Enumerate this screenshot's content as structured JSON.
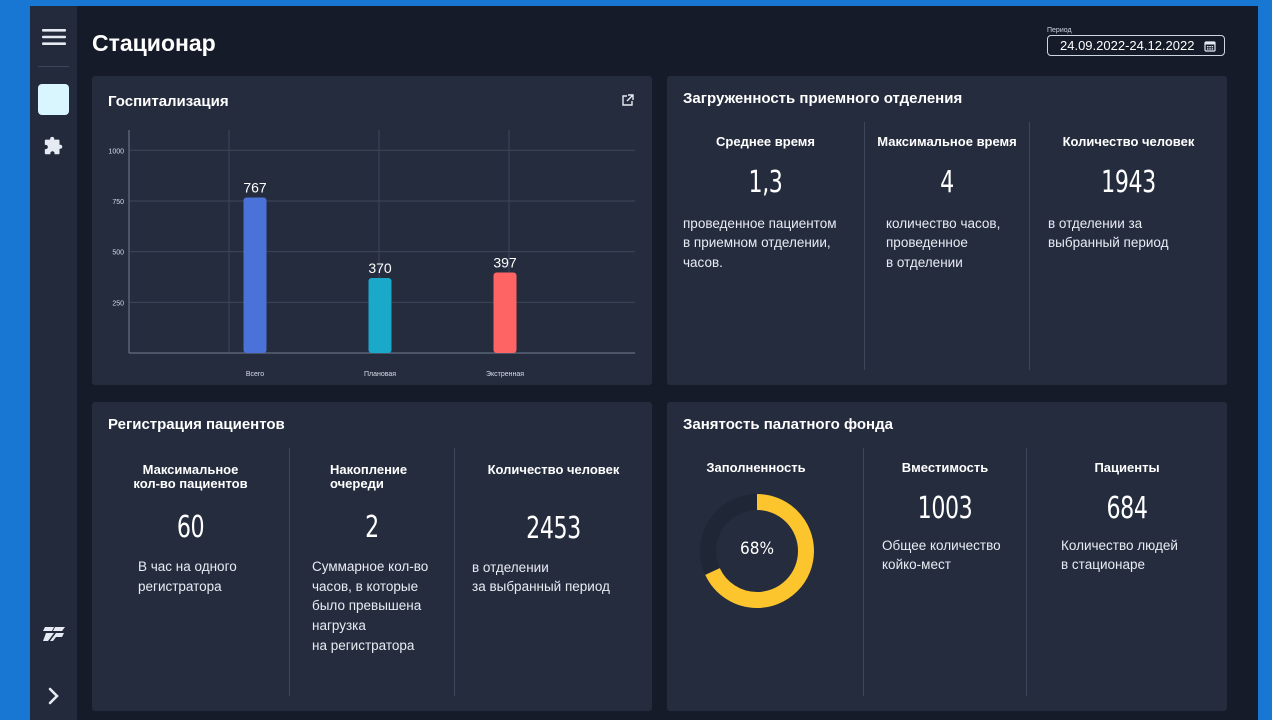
{
  "page": {
    "title": "Стационар"
  },
  "period": {
    "label": "Период",
    "value": "24.09.2022-24.12.2022"
  },
  "sidebar": {
    "icons": [
      "menu-icon",
      "home-tile",
      "puzzle-icon",
      "brand-logo-icon",
      "chevron-right-icon"
    ]
  },
  "hospitalization": {
    "title": "Госпитализация",
    "chart_data": {
      "type": "bar",
      "categories": [
        "Всего",
        "Плановая",
        "Экстренная"
      ],
      "values": [
        767,
        370,
        397
      ],
      "ylim": [
        0,
        1100
      ],
      "yticks": [
        250,
        500,
        750,
        1000
      ],
      "colors": [
        "#4a72d8",
        "#1aa9c8",
        "#ff6464"
      ],
      "grid": true
    }
  },
  "reception": {
    "title": "Загруженность приемного отделения",
    "columns": [
      {
        "head": "Среднее время",
        "value": "1,3",
        "desc": "проведенное пациентом\nв приемном отделении,\nчасов."
      },
      {
        "head": "Максимальное время",
        "value": "4",
        "desc": "количество часов,\nпроведенное\nв отделении"
      },
      {
        "head": "Количество человек",
        "value": "1943",
        "desc": "в отделении за\nвыбранный период"
      }
    ]
  },
  "registration": {
    "title": "Регистрация пациентов",
    "columns": [
      {
        "head": "Максимальное\nкол-во пациентов",
        "value": "60",
        "desc": "В час на одного\nрегистратора"
      },
      {
        "head": "Накопление\nочереди",
        "value": "2",
        "desc": "Суммарное кол-во\nчасов, в которые\n было превышена\nнагрузка\nна регистратора"
      },
      {
        "head": "Количество человек",
        "value": "2453",
        "desc": "в отделении\nза выбранный период"
      }
    ]
  },
  "ward": {
    "title": "Занятость палатного фонда",
    "fill": {
      "head": "Заполненность",
      "value": "68%",
      "percent": 68,
      "color": "#fcc42d"
    },
    "columns": [
      {
        "head": "Вместимость",
        "value": "1003",
        "desc": "Общее количество\nкойко-мест"
      },
      {
        "head": "Пациенты",
        "value": "684",
        "desc": "Количество  людей\nв стационаре"
      }
    ]
  }
}
